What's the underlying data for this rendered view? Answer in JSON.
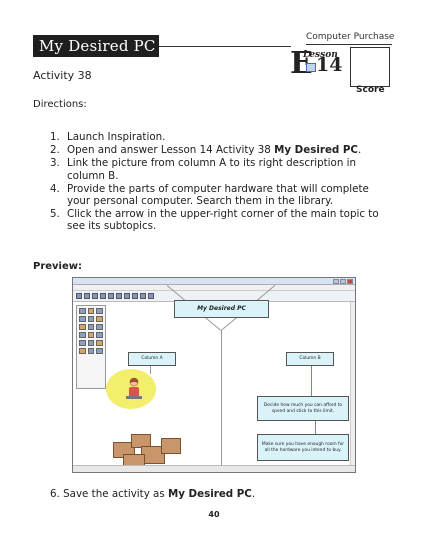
{
  "header": {
    "title": "My Desired PC",
    "category": "Computer Purchase",
    "lesson_word": "Lesson",
    "lesson_letter": "E",
    "lesson_number": "14",
    "score_label": "Score"
  },
  "activity_label": "Activity 38",
  "directions_label": "Directions:",
  "steps": [
    {
      "n": "1.",
      "text": "Launch Inspiration."
    },
    {
      "n": "2.",
      "text": "Open and answer Lesson 14 Activity 38 ",
      "bold": "My Desired PC",
      "after": "."
    },
    {
      "n": "3.",
      "text": "Link the picture from column A to its right description in column B."
    },
    {
      "n": "4.",
      "text": "Provide the parts of computer hardware that will complete your personal computer. Search them in the library."
    },
    {
      "n": "5.",
      "text": "Click the arrow in the upper-right corner of the main topic to see its subtopics."
    }
  ],
  "preview_label": "Preview:",
  "preview": {
    "main_topic": "My Desired PC",
    "column_a": "Column A",
    "column_b": "Column B",
    "note_1": "Decide how much you can afford to spend and stick to this limit.",
    "note_2": "Make sure you have enough room for all the hardware you intend to buy."
  },
  "step6": {
    "n": "6.",
    "text": "Save the activity as ",
    "bold": "My Desired PC",
    "after": "."
  },
  "page_number": "40"
}
